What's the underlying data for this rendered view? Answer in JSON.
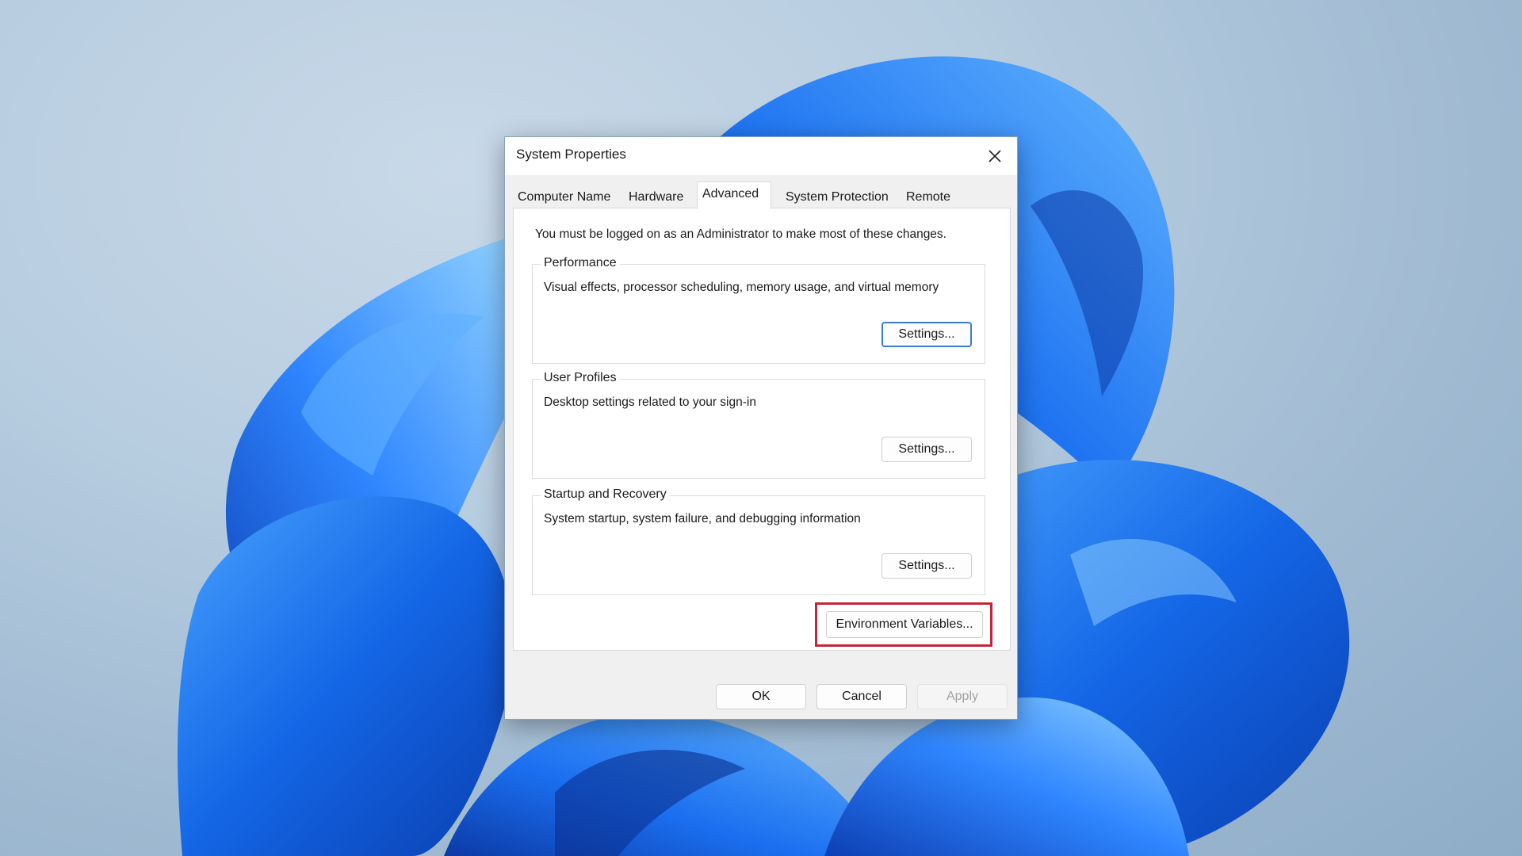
{
  "window": {
    "title": "System Properties",
    "close_icon": "close-icon"
  },
  "tabs": [
    {
      "label": "Computer Name",
      "active": false
    },
    {
      "label": "Hardware",
      "active": false
    },
    {
      "label": "Advanced",
      "active": true
    },
    {
      "label": "System Protection",
      "active": false
    },
    {
      "label": "Remote",
      "active": false
    }
  ],
  "advanced": {
    "admin_note": "You must be logged on as an Administrator to make most of these changes.",
    "performance": {
      "legend": "Performance",
      "description": "Visual effects, processor scheduling, memory usage, and virtual memory",
      "button_label": "Settings..."
    },
    "user_profiles": {
      "legend": "User Profiles",
      "description": "Desktop settings related to your sign-in",
      "button_label": "Settings..."
    },
    "startup_recovery": {
      "legend": "Startup and Recovery",
      "description": "System startup, system failure, and debugging information",
      "button_label": "Settings..."
    },
    "environment_button_label": "Environment Variables...",
    "highlight_color": "#c0283a"
  },
  "footer": {
    "ok_label": "OK",
    "cancel_label": "Cancel",
    "apply_label": "Apply"
  },
  "colors": {
    "accent": "#3c7bd4",
    "wallpaper_blue": "#1565d8"
  }
}
